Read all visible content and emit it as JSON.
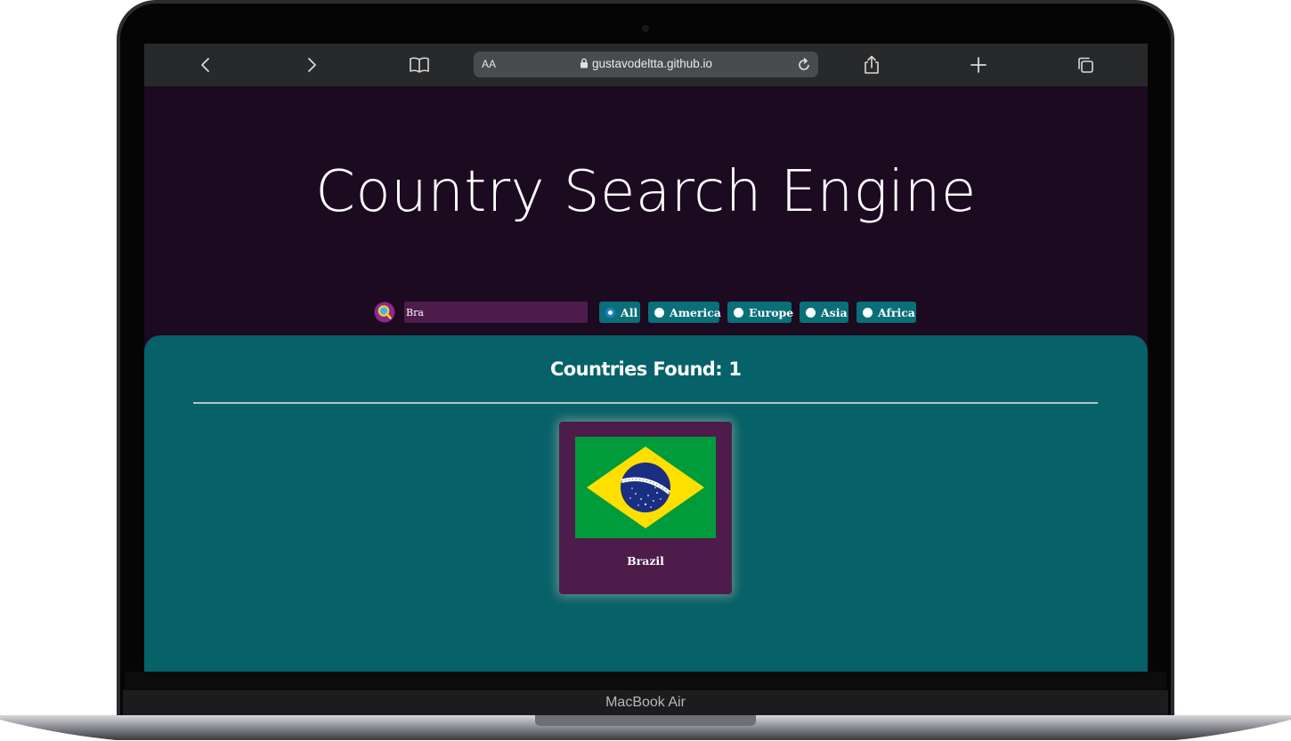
{
  "device": {
    "label": "MacBook Air"
  },
  "browser": {
    "url": "gustavodeltta.github.io",
    "text_size_label": "AA",
    "icons": [
      "chevron-left-icon",
      "chevron-right-icon",
      "book-icon",
      "lock-icon",
      "reload-icon",
      "share-icon",
      "plus-icon",
      "tabs-icon"
    ]
  },
  "app": {
    "title": "Country Search Engine",
    "search": {
      "value": "Bra",
      "icon": "magnifier-icon"
    },
    "filters": [
      {
        "label": "All",
        "checked": true
      },
      {
        "label": "America",
        "checked": false
      },
      {
        "label": "Europe",
        "checked": false
      },
      {
        "label": "Asia",
        "checked": false
      },
      {
        "label": "Africa",
        "checked": false
      }
    ],
    "results": {
      "count_label": "Countries Found:",
      "count": "1",
      "items": [
        {
          "name": "Brazil",
          "flag": "brazil-flag"
        }
      ]
    }
  },
  "colors": {
    "page_bg": "#1c0a21",
    "results_bg": "#076168",
    "card_bg": "#4e1c4b",
    "filter_bg": "#0a6f78",
    "input_bg": "#4e1c4b"
  }
}
